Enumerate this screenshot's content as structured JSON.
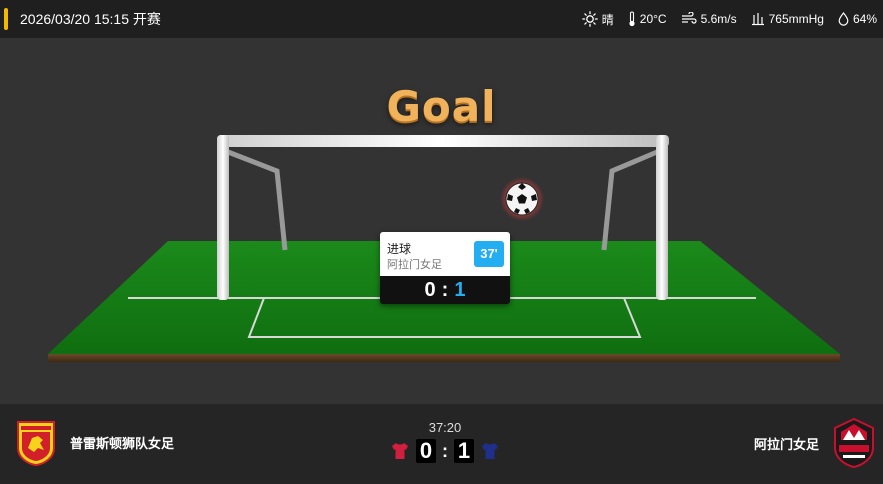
{
  "header": {
    "datetime": "2026/03/20 15:15 开赛",
    "weather": [
      {
        "icon": "sun-icon",
        "text": "晴"
      },
      {
        "icon": "thermometer-icon",
        "text": "20°C"
      },
      {
        "icon": "wind-icon",
        "text": "5.6m/s"
      },
      {
        "icon": "pressure-icon",
        "text": "765mmHg"
      },
      {
        "icon": "humidity-icon",
        "text": "64%"
      }
    ]
  },
  "animation": {
    "title": "Goal",
    "event": {
      "title": "进球",
      "team": "阿拉门女足",
      "minute": "37'",
      "home_score": "0",
      "away_score": "1",
      "separator": ":"
    }
  },
  "match": {
    "home_name": "普雷斯顿狮队女足",
    "away_name": "阿拉门女足",
    "clock": "37:20",
    "home_score": "0",
    "away_score": "1",
    "separator": ":",
    "home_color": "#d1203f",
    "away_color": "#1e2f8c"
  },
  "colors": {
    "accent": "#f5b800",
    "minute_badge": "#22aef0",
    "pitch": "#1c8a1c"
  }
}
